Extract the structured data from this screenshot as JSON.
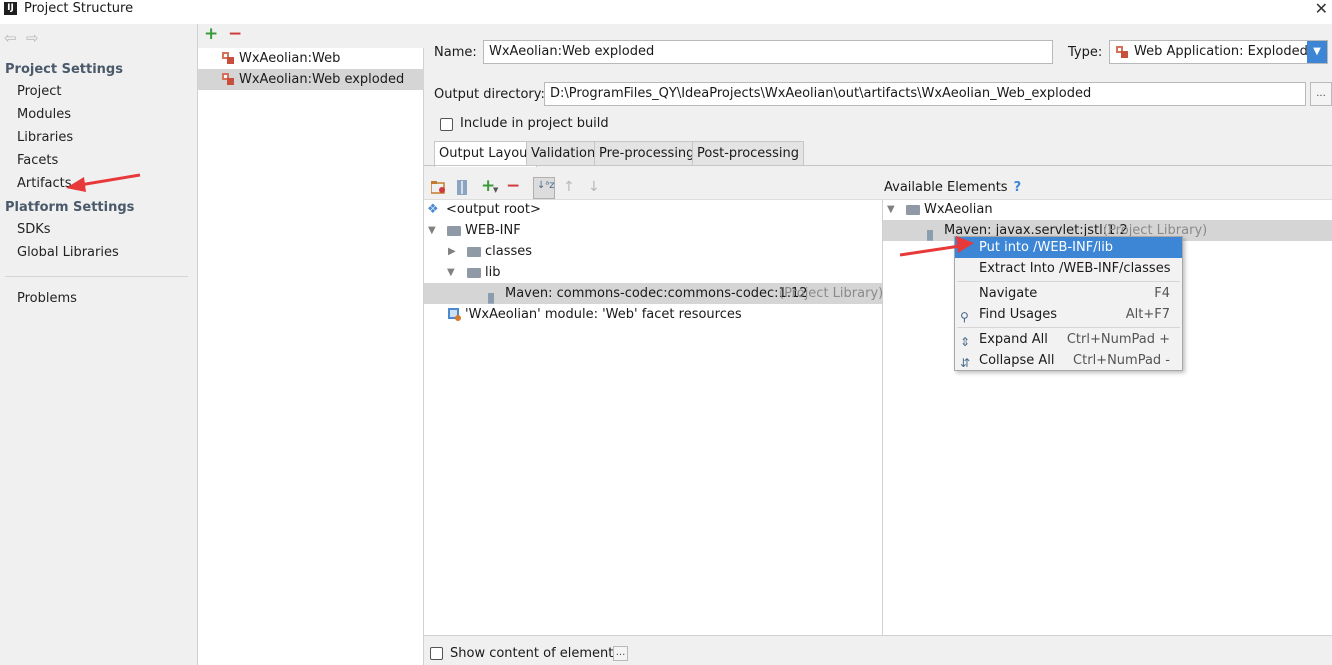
{
  "window": {
    "app_icon": "IJ",
    "title": "Project Structure",
    "close": "✕"
  },
  "sidebar": {
    "project_settings_heading": "Project Settings",
    "project_settings_items": [
      "Project",
      "Modules",
      "Libraries",
      "Facets",
      "Artifacts"
    ],
    "platform_settings_heading": "Platform Settings",
    "platform_settings_items": [
      "SDKs",
      "Global Libraries"
    ],
    "problems": "Problems"
  },
  "artifacts": {
    "add": "+",
    "remove": "−",
    "items": [
      "WxAeolian:Web",
      "WxAeolian:Web exploded"
    ],
    "selected_index": 1
  },
  "artifact_form": {
    "name_label": "Name:",
    "name_value": "WxAeolian:Web exploded",
    "type_label": "Type:",
    "type_value": "Web Application: Exploded",
    "output_dir_label": "Output directory:",
    "output_dir_value": "D:\\ProgramFiles_QY\\IdeaProjects\\WxAeolian\\out\\artifacts\\WxAeolian_Web_exploded",
    "browse": "...",
    "include_in_build_label": "Include in project build",
    "include_in_build_checked": false
  },
  "tabs": [
    "Output Layout",
    "Validation",
    "Pre-processing",
    "Post-processing"
  ],
  "active_tab": "Output Layout",
  "output_layout": {
    "tree": {
      "root": "<output root>",
      "web_inf": "WEB-INF",
      "classes": "classes",
      "lib": "lib",
      "lib_item": "Maven: commons-codec:commons-codec:1.12",
      "lib_item_note": "(Project Library)",
      "facet_resources": "'WxAeolian' module: 'Web' facet resources"
    }
  },
  "available_elements": {
    "heading": "Available Elements",
    "help": "?",
    "module": "WxAeolian",
    "library": "Maven: javax.servlet:jstl:1.2",
    "library_note": "(Project Library)"
  },
  "bottom": {
    "show_content_label": "Show content of elements",
    "show_content_checked": false,
    "more": "..."
  },
  "context_menu": {
    "items": [
      {
        "label": "Put into /WEB-INF/lib",
        "shortcut": "",
        "highlighted": true
      },
      {
        "label": "Extract Into /WEB-INF/classes",
        "shortcut": ""
      },
      {
        "label": "Navigate",
        "shortcut": "F4"
      },
      {
        "label": "Find Usages",
        "shortcut": "Alt+F7"
      },
      {
        "label": "Expand All",
        "shortcut": "Ctrl+NumPad +"
      },
      {
        "label": "Collapse All",
        "shortcut": "Ctrl+NumPad -"
      }
    ]
  },
  "colors": {
    "selection": "#3d86d6",
    "annotation_arrow": "#e8393a",
    "panel_bg": "#f0f0f0"
  }
}
